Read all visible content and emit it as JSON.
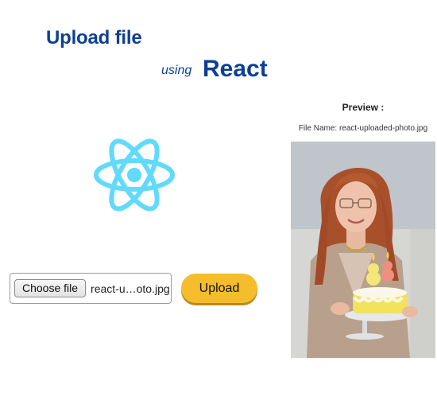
{
  "header": {
    "title": "Upload file",
    "subtitle_prefix": "using",
    "subtitle_main": "React"
  },
  "logo": {
    "icon": "react-logo-icon",
    "color": "#61dafb"
  },
  "upload_form": {
    "choose_button_label": "Choose file",
    "selected_file_display": "react-u…oto.jpg",
    "upload_button_label": "Upload",
    "upload_button_color": "#f5bd2c"
  },
  "preview": {
    "heading": "Preview :",
    "file_name_text": "File Name: react-uploaded-photo.jpg"
  },
  "colors": {
    "heading": "#0d3f96"
  }
}
